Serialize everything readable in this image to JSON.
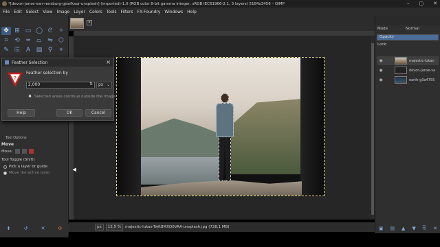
{
  "window": {
    "title": "*[devon-janse-van-rensburg-gjsofkxqr-unsplash] (imported)-1.0 (RGB color 8-bit gamma integer, sRGB IEC61966-2.1, 3 layers) 5184x3456 – GIMP",
    "controls": [
      "–",
      "▢",
      "✕"
    ]
  },
  "menu": [
    "File",
    "Edit",
    "Select",
    "View",
    "Image",
    "Layer",
    "Colors",
    "Tools",
    "Filters",
    "FX-Foundry",
    "Windows",
    "Help"
  ],
  "dialog": {
    "title": "Feather Selection",
    "heading": "Feather selection by",
    "value": "2,000",
    "unit": "px",
    "checkbox_label": "Selected areas continue outside the image",
    "checkbox_checked": true,
    "help": "Help",
    "ok": "OK",
    "cancel": "Cancel"
  },
  "tool_options": {
    "tab": "Tool Options",
    "title": "Move",
    "mode_label": "Move:",
    "toggle_label": "Tool Toggle (Shift)",
    "radio1": "Pick a layer or guide",
    "radio2": "Move the active layer"
  },
  "status": {
    "unit": "px",
    "zoom": "12,5 %",
    "layer_info": "majestic-lukas-Twft8MXD0VAA-unsplash.jpg (728,1 MB)"
  },
  "layers_panel": {
    "mode_label": "Mode",
    "mode_value": "Normal",
    "opacity_label": "Opacity",
    "lock_label": "Lock:",
    "layers": [
      {
        "name": "majestic-lukas-",
        "selected": true
      },
      {
        "name": "devon-janse-va",
        "selected": false
      },
      {
        "name": "earth-g3a4755",
        "selected": false
      }
    ]
  },
  "icons": {
    "tools": [
      "move-icon",
      "align-icon",
      "rect-select-icon",
      "ellipse-select-icon",
      "lasso-icon",
      "fuzzy-select-icon",
      "crop-icon",
      "unified-transform-icon",
      "warp-icon",
      "perspective-icon",
      "flip-icon",
      "cage-icon"
    ]
  }
}
